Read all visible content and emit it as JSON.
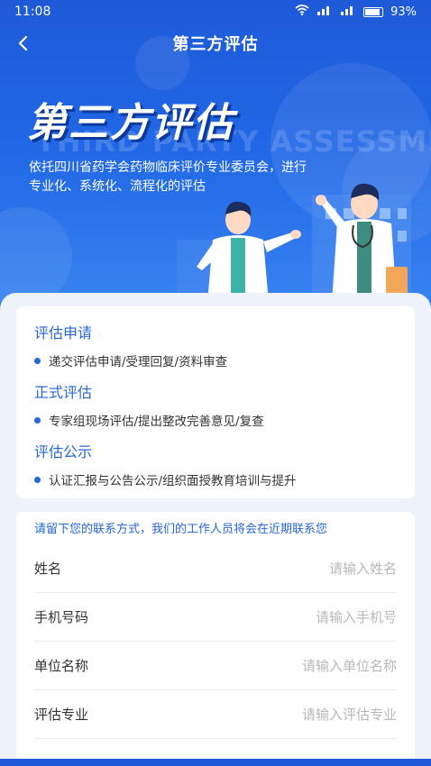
{
  "status_bar": {
    "time": "11:08",
    "battery_text": "93%",
    "icons": [
      "wifi-icon",
      "signal-icon",
      "signal-icon",
      "battery-icon"
    ]
  },
  "nav": {
    "back_icon": "chevron-left-icon",
    "title": "第三方评估"
  },
  "hero": {
    "title": "第三方评估",
    "watermark": "THIRD PARTY ASSESSMENT",
    "description": "依托四川省药学会药物临床评价专业委员会，进行专业化、系统化、流程化的评估"
  },
  "process": {
    "sections": [
      {
        "title": "评估申请",
        "item": "递交评估申请/受理回复/资料审查"
      },
      {
        "title": "正式评估",
        "item": "专家组现场评估/提出整改完善意见/复查"
      },
      {
        "title": "评估公示",
        "item": "认证汇报与公告公示/组织面授教育培训与提升"
      }
    ]
  },
  "form": {
    "hint": "请留下您的联系方式，我们的工作人员将会在近期联系您",
    "fields": [
      {
        "label": "姓名",
        "placeholder": "请输入姓名",
        "value": ""
      },
      {
        "label": "手机号码",
        "placeholder": "请输入手机号",
        "value": ""
      },
      {
        "label": "单位名称",
        "placeholder": "请输入单位名称",
        "value": ""
      },
      {
        "label": "评估专业",
        "placeholder": "请输入评估专业",
        "value": ""
      }
    ]
  },
  "colors": {
    "primary": "#2666d8",
    "hero_top": "#1e5ad8",
    "page_bg": "#eef3fb"
  }
}
